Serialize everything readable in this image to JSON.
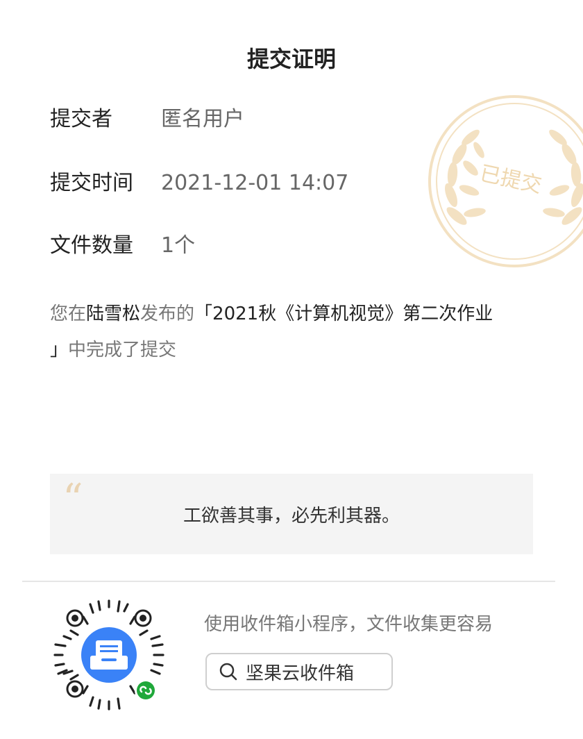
{
  "header": {
    "title": "提交证明"
  },
  "info": {
    "submitter_label": "提交者",
    "submitter_value": "匿名用户",
    "time_label": "提交时间",
    "time_value": "2021-12-01 14:07",
    "count_label": "文件数量",
    "count_value": "1个"
  },
  "stamp": {
    "text": "已提交",
    "color": "#f0dcb8"
  },
  "description": {
    "prefix": "您在",
    "publisher": "陆雪松",
    "mid": "发布的",
    "task_line1": "「2021秋《计算机视觉》第二次作业",
    "task_line2": "」",
    "suffix": "中完成了提交"
  },
  "quote": {
    "mark": "“",
    "text": "工欲善其事，必先利其器。"
  },
  "footer": {
    "promo_text": "使用收件箱小程序，文件收集更容易",
    "search_label": "坚果云收件箱",
    "qr_icon": "inbox-tray-icon",
    "qr_badge_icon": "mini-program-link-icon",
    "accent_color": "#3a82f7",
    "badge_color": "#1fa83a"
  }
}
